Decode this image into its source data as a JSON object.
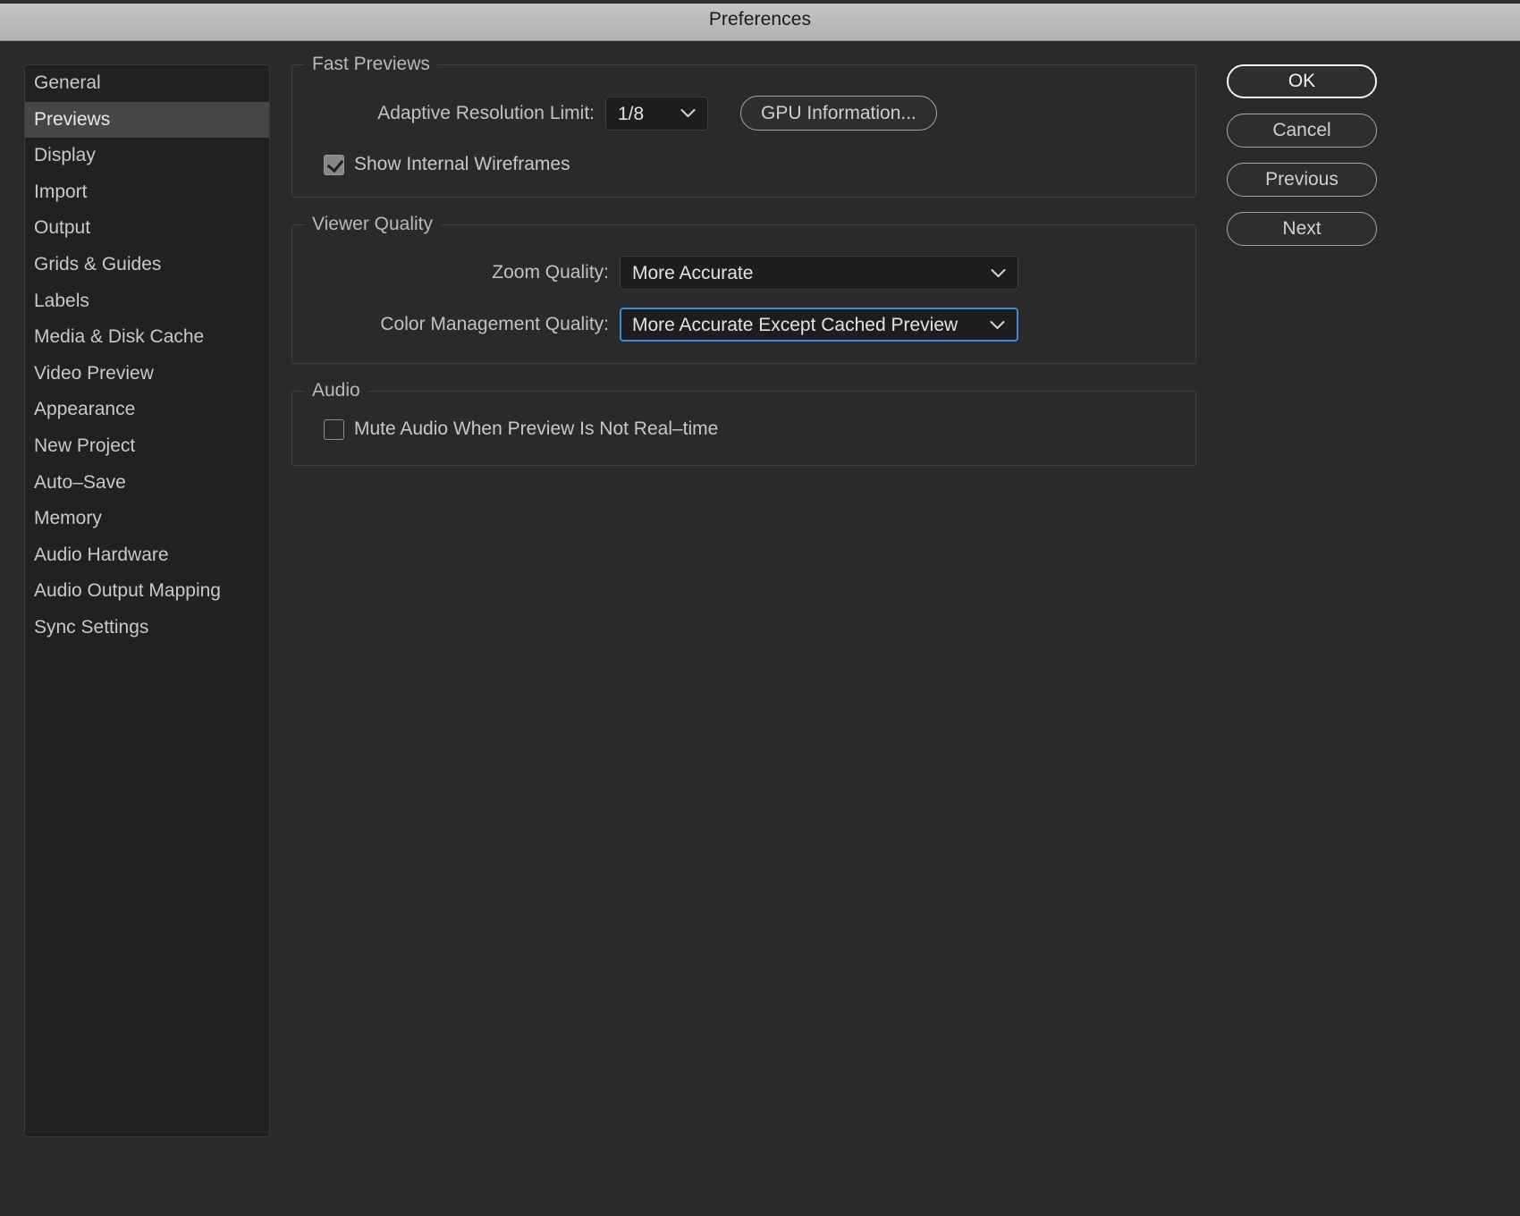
{
  "window": {
    "title": "Preferences"
  },
  "sidebar": {
    "items": [
      {
        "label": "General",
        "selected": false
      },
      {
        "label": "Previews",
        "selected": true
      },
      {
        "label": "Display",
        "selected": false
      },
      {
        "label": "Import",
        "selected": false
      },
      {
        "label": "Output",
        "selected": false
      },
      {
        "label": "Grids & Guides",
        "selected": false
      },
      {
        "label": "Labels",
        "selected": false
      },
      {
        "label": "Media & Disk Cache",
        "selected": false
      },
      {
        "label": "Video Preview",
        "selected": false
      },
      {
        "label": "Appearance",
        "selected": false
      },
      {
        "label": "New Project",
        "selected": false
      },
      {
        "label": "Auto–Save",
        "selected": false
      },
      {
        "label": "Memory",
        "selected": false
      },
      {
        "label": "Audio Hardware",
        "selected": false
      },
      {
        "label": "Audio Output Mapping",
        "selected": false
      },
      {
        "label": "Sync Settings",
        "selected": false
      }
    ]
  },
  "fast_previews": {
    "legend": "Fast Previews",
    "adaptive_resolution_label": "Adaptive Resolution Limit:",
    "adaptive_resolution_value": "1/8",
    "gpu_button": "GPU Information...",
    "wireframes_label": "Show Internal Wireframes",
    "wireframes_checked": true
  },
  "viewer_quality": {
    "legend": "Viewer Quality",
    "zoom_quality_label": "Zoom Quality:",
    "zoom_quality_value": "More Accurate",
    "color_management_label": "Color Management Quality:",
    "color_management_value": "More Accurate Except Cached Preview",
    "color_management_focused": true
  },
  "audio": {
    "legend": "Audio",
    "mute_label": "Mute Audio When Preview Is Not Real–time",
    "mute_checked": false
  },
  "buttons": {
    "ok": "OK",
    "cancel": "Cancel",
    "previous": "Previous",
    "next": "Next"
  },
  "colors": {
    "dialog_background": "#2a2a2a",
    "sidebar_background": "#212121",
    "sidebar_selected": "#464646",
    "titlebar": "#bdbdbd",
    "focus_blue": "#3b8bde",
    "text_primary": "#c9c9c9"
  },
  "icons": {
    "chevron_down": "ˇ",
    "check": "✓"
  }
}
